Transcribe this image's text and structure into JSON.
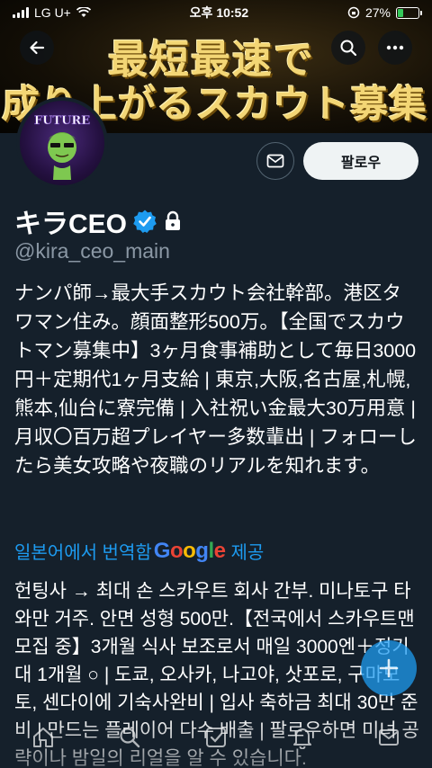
{
  "status_bar": {
    "carrier": "LG U+",
    "time": "오후 10:52",
    "battery": "27%",
    "battery_level": 0.27
  },
  "banner": {
    "line1": "最短最速で",
    "line2": "成り上がるスカウト募集"
  },
  "avatar_text": "FUTURE",
  "actions": {
    "follow_label": "팔로우"
  },
  "profile": {
    "display_name": "キラCEO",
    "handle": "@kira_ceo_main",
    "bio": "ナンパ師→最大手スカウト会社幹部。港区タワマン住み。顔面整形500万。【全国でスカウトマン募集中】3ヶ月食事補助として毎日3000円＋定期代1ヶ月支給 | 東京,大阪,名古屋,札幌,熊本,仙台に寮完備 | 入社祝い金最大30万用意 | 月収〇百万超プレイヤー多数輩出 | フォローしたら美女攻略や夜職のリアルを知れます。",
    "translated_from": "일본어에서 번역함",
    "google": "Google",
    "provided": "제공",
    "translation": "헌팅사 → 최대 손 스카우트 회사 간부. 미나토구 타와만 거주. 안면 성형 500만.【전국에서 스카우트맨 모집 중】3개월 식사 보조로서 매일 3000엔＋정기대 1개월 ○ | 도쿄, 오사카, 나고야, 삿포로, 구마모토, 센다이에 기숙사완비 | 입사 축하금 최대 30만 준비 | 만드는 플레이어 다수 배출 | 팔로우하면 미녀 공략이나 밤일의 리얼을 알 수 있습니다."
  },
  "colors": {
    "background": "#15202b",
    "accent": "#1d9bf0",
    "verified": "#1d9bf0"
  }
}
